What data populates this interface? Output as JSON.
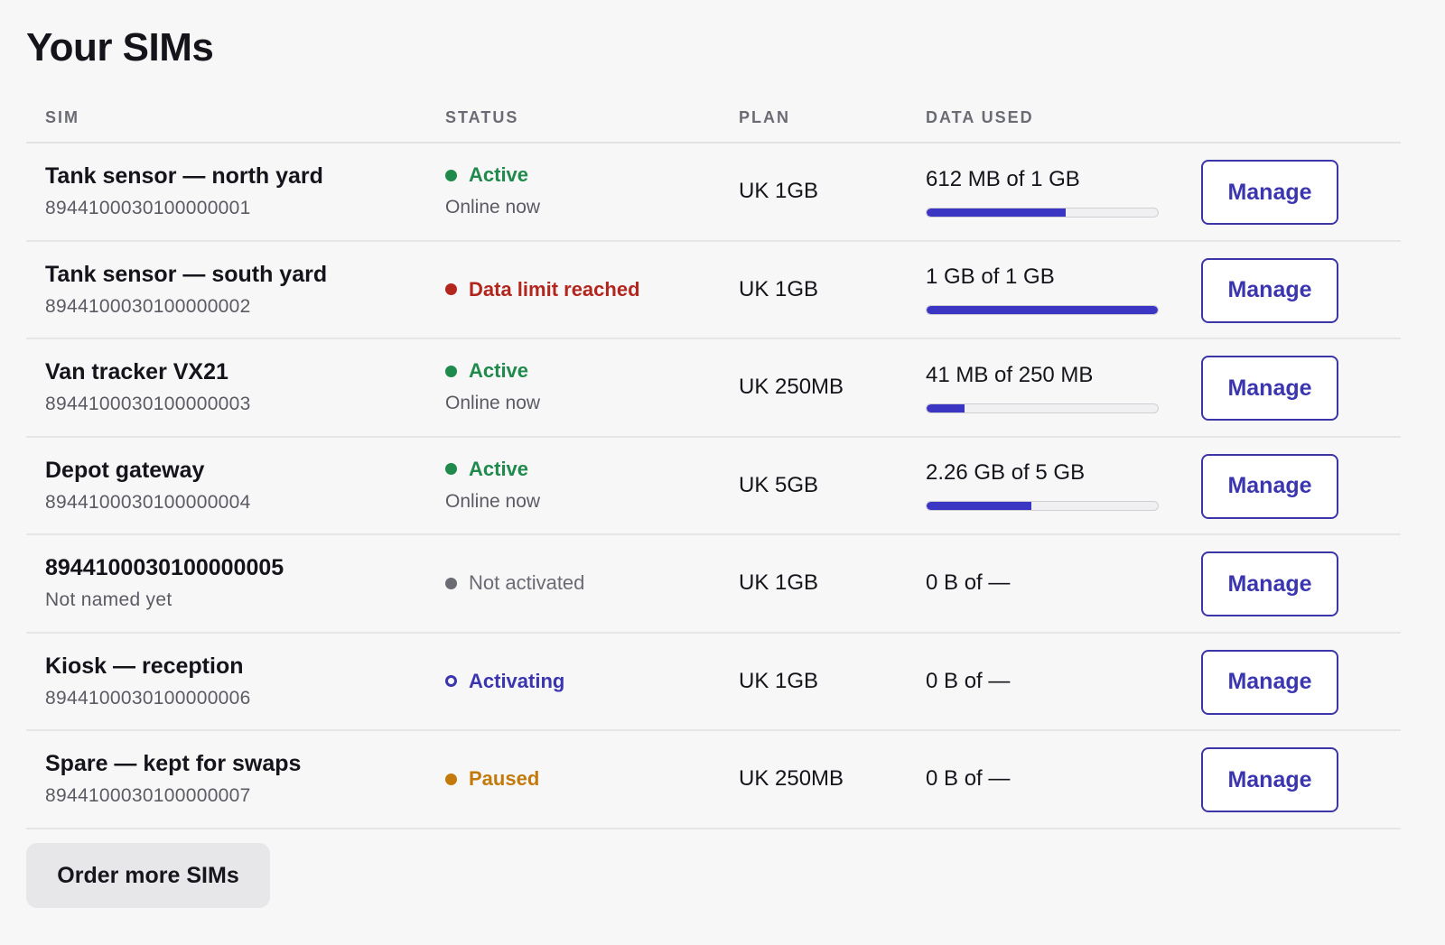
{
  "page_title": "Your SIMs",
  "columns": {
    "sim": "SIM",
    "status": "STATUS",
    "plan": "PLAN",
    "data_used": "DATA USED"
  },
  "status_colors": {
    "active": "#1f8a4c",
    "limit": "#b3261e",
    "inactive": "#6b6b74",
    "activating": "#3b35b0",
    "paused": "#c47a0a"
  },
  "accent_color": "#3b35c4",
  "rows": [
    {
      "name": "Tank sensor — north yard",
      "sub": "8944100030100000001",
      "status": "Active",
      "status_kind": "active",
      "status_sub": "Online now",
      "plan": "UK 1GB",
      "data": "612 MB of 1 GB",
      "usage_fraction": 0.6,
      "manage": "Manage"
    },
    {
      "name": "Tank sensor — south yard",
      "sub": "8944100030100000002",
      "status": "Data limit reached",
      "status_kind": "limit",
      "status_sub": "",
      "plan": "UK 1GB",
      "data": "1 GB of 1 GB",
      "usage_fraction": 1.0,
      "manage": "Manage"
    },
    {
      "name": "Van tracker VX21",
      "sub": "8944100030100000003",
      "status": "Active",
      "status_kind": "active",
      "status_sub": "Online now",
      "plan": "UK 250MB",
      "data": "41 MB of 250 MB",
      "usage_fraction": 0.164,
      "manage": "Manage"
    },
    {
      "name": "Depot gateway",
      "sub": "8944100030100000004",
      "status": "Active",
      "status_kind": "active",
      "status_sub": "Online now",
      "plan": "UK 5GB",
      "data": "2.26 GB of 5 GB",
      "usage_fraction": 0.452,
      "manage": "Manage"
    },
    {
      "name": "8944100030100000005",
      "sub": "Not named yet",
      "status": "Not activated",
      "status_kind": "inactive",
      "status_sub": "",
      "plan": "UK 1GB",
      "data": "0 B of —",
      "usage_fraction": null,
      "manage": "Manage"
    },
    {
      "name": "Kiosk — reception",
      "sub": "8944100030100000006",
      "status": "Activating",
      "status_kind": "activating",
      "status_sub": "",
      "plan": "UK 1GB",
      "data": "0 B of —",
      "usage_fraction": null,
      "manage": "Manage"
    },
    {
      "name": "Spare — kept for swaps",
      "sub": "8944100030100000007",
      "status": "Paused",
      "status_kind": "paused",
      "status_sub": "",
      "plan": "UK 250MB",
      "data": "0 B of —",
      "usage_fraction": null,
      "manage": "Manage"
    }
  ],
  "order_button": "Order more SIMs"
}
